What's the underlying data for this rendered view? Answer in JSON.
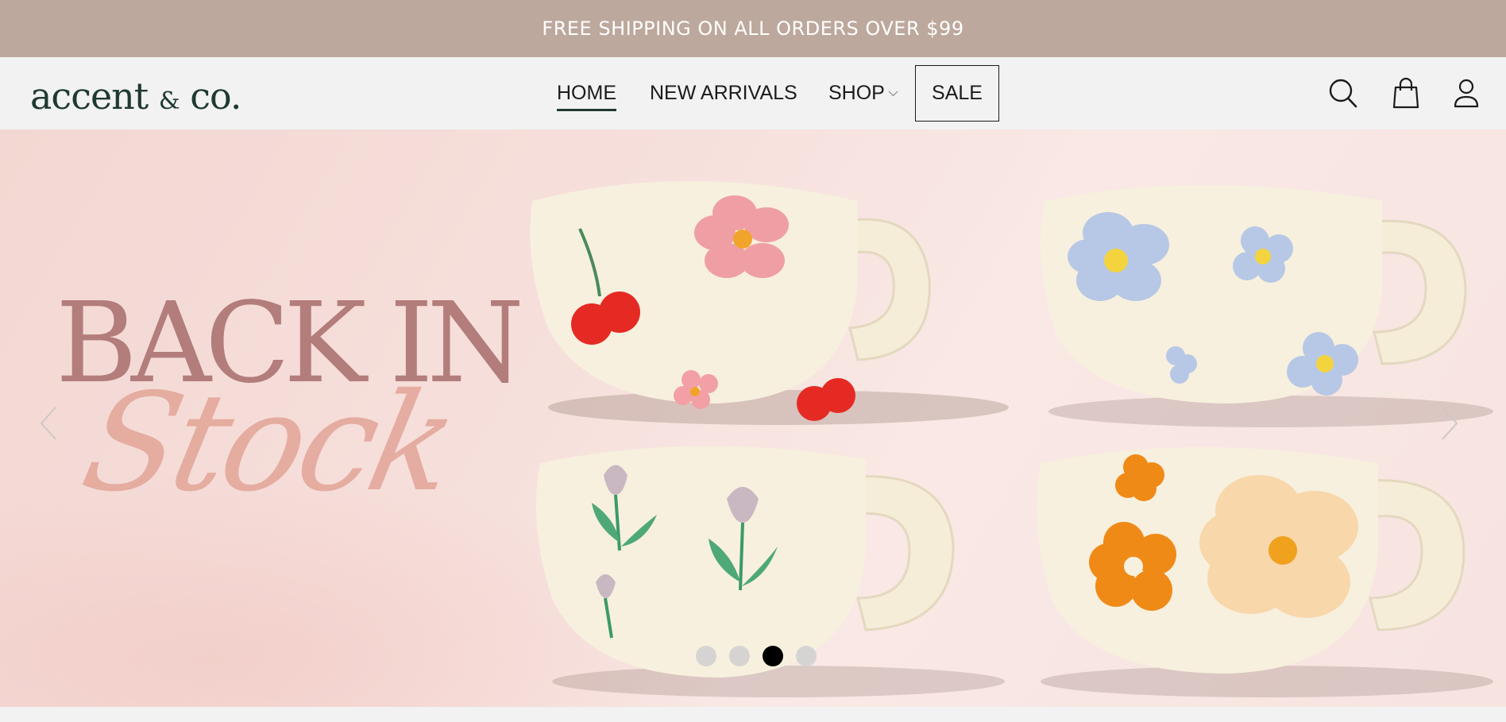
{
  "announcement": {
    "text": "FREE SHIPPING ON ALL ORDERS OVER $99"
  },
  "header": {
    "logo": {
      "main": "accent",
      "amp": "&",
      "end": "co."
    },
    "nav": [
      {
        "label": "HOME",
        "active": true
      },
      {
        "label": "NEW ARRIVALS"
      },
      {
        "label": "SHOP",
        "has_dropdown": true,
        "icon": "chevron-down-icon"
      },
      {
        "label": "SALE",
        "boxed": true
      }
    ],
    "icons": [
      "search-icon",
      "shopping-bag-icon",
      "user-icon"
    ]
  },
  "hero": {
    "title_line1": "BACK IN",
    "title_line2": "Stock",
    "slides_count": 4,
    "active_slide": 3,
    "prev_icon": "chevron-left-icon",
    "next_icon": "chevron-right-icon"
  },
  "colors": {
    "announcement_bg": "#bda89d",
    "header_bg": "#f2f2f2",
    "logo": "#1f3a30",
    "title": "#b27d7b",
    "script": "#e2a396",
    "hero_bg": "#f6dfdb"
  }
}
